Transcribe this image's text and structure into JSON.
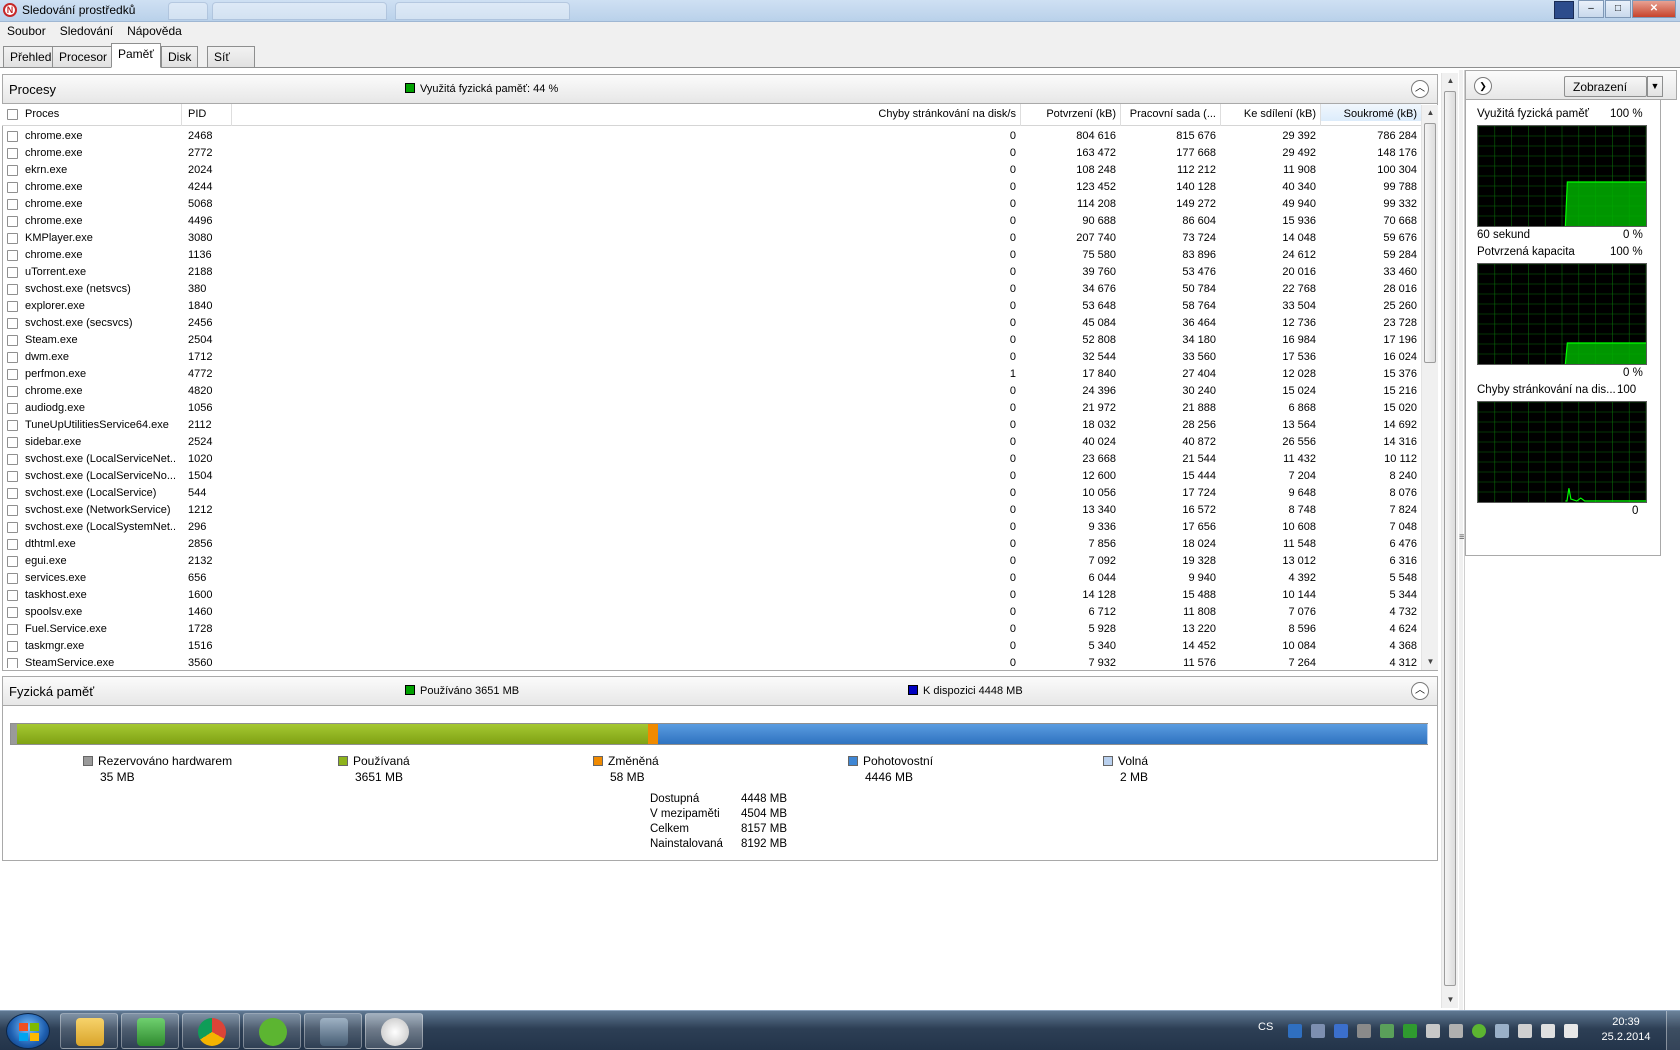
{
  "window": {
    "title": "Sledování prostředků",
    "close": "✕",
    "minimize": "–",
    "maximize": "□"
  },
  "menu": [
    "Soubor",
    "Sledování",
    "Nápověda"
  ],
  "tabs": [
    "Přehled",
    "Procesor",
    "Paměť",
    "Disk",
    "Síť"
  ],
  "active_tab": "Paměť",
  "processes": {
    "title": "Procesy",
    "legend": "Využitá fyzická paměť: 44 %",
    "legend_color": "#00a000",
    "columns": [
      "Proces",
      "PID",
      "Chyby stránkování na disk/s",
      "Potvrzení (kB)",
      "Pracovní sada (...",
      "Ke sdílení (kB)",
      "Soukromé (kB)"
    ],
    "rows": [
      [
        "chrome.exe",
        "2468",
        "0",
        "804 616",
        "815 676",
        "29 392",
        "786 284"
      ],
      [
        "chrome.exe",
        "2772",
        "0",
        "163 472",
        "177 668",
        "29 492",
        "148 176"
      ],
      [
        "ekrn.exe",
        "2024",
        "0",
        "108 248",
        "112 212",
        "11 908",
        "100 304"
      ],
      [
        "chrome.exe",
        "4244",
        "0",
        "123 452",
        "140 128",
        "40 340",
        "99 788"
      ],
      [
        "chrome.exe",
        "5068",
        "0",
        "114 208",
        "149 272",
        "49 940",
        "99 332"
      ],
      [
        "chrome.exe",
        "4496",
        "0",
        "90 688",
        "86 604",
        "15 936",
        "70 668"
      ],
      [
        "KMPlayer.exe",
        "3080",
        "0",
        "207 740",
        "73 724",
        "14 048",
        "59 676"
      ],
      [
        "chrome.exe",
        "1136",
        "0",
        "75 580",
        "83 896",
        "24 612",
        "59 284"
      ],
      [
        "uTorrent.exe",
        "2188",
        "0",
        "39 760",
        "53 476",
        "20 016",
        "33 460"
      ],
      [
        "svchost.exe (netsvcs)",
        "380",
        "0",
        "34 676",
        "50 784",
        "22 768",
        "28 016"
      ],
      [
        "explorer.exe",
        "1840",
        "0",
        "53 648",
        "58 764",
        "33 504",
        "25 260"
      ],
      [
        "svchost.exe (secsvcs)",
        "2456",
        "0",
        "45 084",
        "36 464",
        "12 736",
        "23 728"
      ],
      [
        "Steam.exe",
        "2504",
        "0",
        "52 808",
        "34 180",
        "16 984",
        "17 196"
      ],
      [
        "dwm.exe",
        "1712",
        "0",
        "32 544",
        "33 560",
        "17 536",
        "16 024"
      ],
      [
        "perfmon.exe",
        "4772",
        "1",
        "17 840",
        "27 404",
        "12 028",
        "15 376"
      ],
      [
        "chrome.exe",
        "4820",
        "0",
        "24 396",
        "30 240",
        "15 024",
        "15 216"
      ],
      [
        "audiodg.exe",
        "1056",
        "0",
        "21 972",
        "21 888",
        "6 868",
        "15 020"
      ],
      [
        "TuneUpUtilitiesService64.exe",
        "2112",
        "0",
        "18 032",
        "28 256",
        "13 564",
        "14 692"
      ],
      [
        "sidebar.exe",
        "2524",
        "0",
        "40 024",
        "40 872",
        "26 556",
        "14 316"
      ],
      [
        "svchost.exe (LocalServiceNet...",
        "1020",
        "0",
        "23 668",
        "21 544",
        "11 432",
        "10 112"
      ],
      [
        "svchost.exe (LocalServiceNo...",
        "1504",
        "0",
        "12 600",
        "15 444",
        "7 204",
        "8 240"
      ],
      [
        "svchost.exe (LocalService)",
        "544",
        "0",
        "10 056",
        "17 724",
        "9 648",
        "8 076"
      ],
      [
        "svchost.exe (NetworkService)",
        "1212",
        "0",
        "13 340",
        "16 572",
        "8 748",
        "7 824"
      ],
      [
        "svchost.exe (LocalSystemNet...",
        "296",
        "0",
        "9 336",
        "17 656",
        "10 608",
        "7 048"
      ],
      [
        "dthtml.exe",
        "2856",
        "0",
        "7 856",
        "18 024",
        "11 548",
        "6 476"
      ],
      [
        "egui.exe",
        "2132",
        "0",
        "7 092",
        "19 328",
        "13 012",
        "6 316"
      ],
      [
        "services.exe",
        "656",
        "0",
        "6 044",
        "9 940",
        "4 392",
        "5 548"
      ],
      [
        "taskhost.exe",
        "1600",
        "0",
        "14 128",
        "15 488",
        "10 144",
        "5 344"
      ],
      [
        "spoolsv.exe",
        "1460",
        "0",
        "6 712",
        "11 808",
        "7 076",
        "4 732"
      ],
      [
        "Fuel.Service.exe",
        "1728",
        "0",
        "5 928",
        "13 220",
        "8 596",
        "4 624"
      ],
      [
        "taskmgr.exe",
        "1516",
        "0",
        "5 340",
        "14 452",
        "10 084",
        "4 368"
      ],
      [
        "SteamService.exe",
        "3560",
        "0",
        "7 932",
        "11 576",
        "7 264",
        "4 312"
      ]
    ]
  },
  "physical": {
    "title": "Fyzická paměť",
    "used_legend": "Používáno 3651 MB",
    "used_color": "#00a000",
    "avail_legend": "K dispozici 4448 MB",
    "avail_color": "#0000c0",
    "bar_fractions": {
      "reserved": 0.0043,
      "used": 0.4469,
      "modified": 0.0071,
      "standby": 0.5442,
      "free": 0.0002
    },
    "bar_colors": {
      "reserved": "#9a9a9a",
      "used": "#8db31b",
      "modified": "#f08a00",
      "standby": "#3e86d4",
      "free": "#b9d0ee"
    },
    "legend": [
      {
        "label": "Rezervováno hardwarem",
        "value": "35 MB",
        "color": "#9a9a9a"
      },
      {
        "label": "Používaná",
        "value": "3651 MB",
        "color": "#8db31b"
      },
      {
        "label": "Změněná",
        "value": "58 MB",
        "color": "#f08a00"
      },
      {
        "label": "Pohotovostní",
        "value": "4446 MB",
        "color": "#3e86d4"
      },
      {
        "label": "Volná",
        "value": "2 MB",
        "color": "#b9d0ee"
      }
    ],
    "stats": [
      {
        "label": "Dostupná",
        "value": "4448 MB"
      },
      {
        "label": "V mezipaměti",
        "value": "4504 MB"
      },
      {
        "label": "Celkem",
        "value": "8157 MB"
      },
      {
        "label": "Nainstalovaná",
        "value": "8192 MB"
      }
    ]
  },
  "right": {
    "view_button": "Zobrazení",
    "graphs": [
      {
        "title": "Využitá fyzická paměť",
        "top": "100 %",
        "bottom_left": "60 sekund",
        "bottom_right": "0 %",
        "level": 0.44,
        "start_fraction": 0.52
      },
      {
        "title": "Potvrzená kapacita",
        "top": "100 %",
        "bottom_left": "",
        "bottom_right": "0 %",
        "level": 0.21,
        "start_fraction": 0.52
      },
      {
        "title": "Chyby stránkování na dis...",
        "top": "100",
        "bottom_left": "",
        "bottom_right": "0",
        "level": 0.0,
        "start_fraction": 0.52
      }
    ],
    "graph_line_color": "#00ff00",
    "graph_fill_color": "#00b000"
  },
  "taskbar": {
    "language": "CS",
    "time": "20:39",
    "date": "25.2.2014"
  }
}
